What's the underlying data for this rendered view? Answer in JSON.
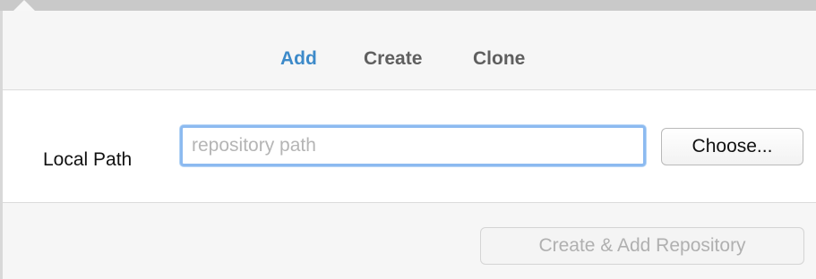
{
  "tabs": [
    {
      "label": "Add",
      "active": true
    },
    {
      "label": "Create",
      "active": false
    },
    {
      "label": "Clone",
      "active": false
    }
  ],
  "form": {
    "local_path_label": "Local Path",
    "path_value": "",
    "path_placeholder": "repository path",
    "choose_label": "Choose..."
  },
  "footer": {
    "create_add_label": "Create & Add Repository",
    "create_add_enabled": false
  },
  "colors": {
    "accent": "#3d8ac9",
    "focus_ring": "#8cbaf0",
    "disabled_text": "#b0b0b0"
  }
}
